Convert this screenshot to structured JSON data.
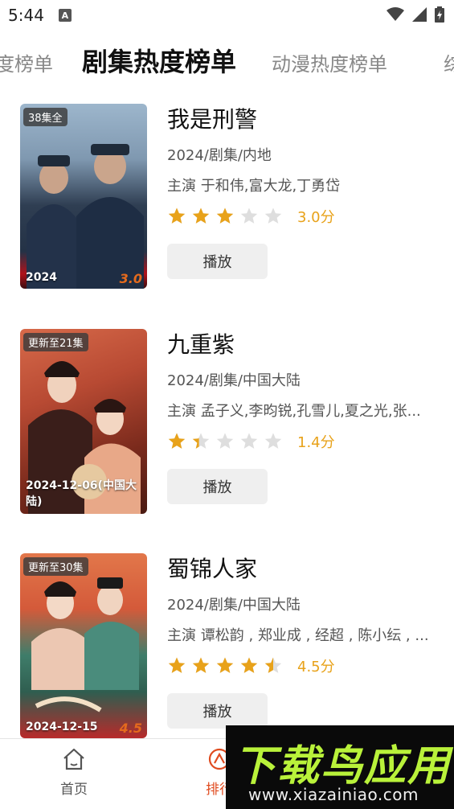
{
  "status": {
    "time": "5:44",
    "notif_icon": "A"
  },
  "tabs": [
    {
      "label": "度榜单",
      "active": false
    },
    {
      "label": "剧集热度榜单",
      "active": true
    },
    {
      "label": "动漫热度榜单",
      "active": false
    },
    {
      "label": "综",
      "active": false
    }
  ],
  "items": [
    {
      "title": "我是刑警",
      "badge": "38集全",
      "date": "2024",
      "poster_score": "3.0",
      "meta": "2024/剧集/内地",
      "cast": "主演 于和伟,富大龙,丁勇岱",
      "rating": 3.0,
      "rating_text": "3.0分",
      "play_label": "播放",
      "poster_colors": [
        "#8aa5bf",
        "#2d3b4e",
        "#b0121a"
      ]
    },
    {
      "title": "九重紫",
      "badge": "更新至21集",
      "date": "2024-12-06(中国大陆)",
      "poster_score": "",
      "meta": "2024/剧集/中国大陆",
      "cast": "主演 孟子义,李昀锐,孔雪儿,夏之光,张...",
      "rating": 1.4,
      "rating_text": "1.4分",
      "play_label": "播放",
      "poster_colors": [
        "#c9513a",
        "#6e2418",
        "#e7a07a"
      ]
    },
    {
      "title": "蜀锦人家",
      "badge": "更新至30集",
      "date": "2024-12-15",
      "poster_score": "4.5",
      "meta": "2024/剧集/中国大陆",
      "cast": "主演 谭松韵 , 郑业成 , 经超 , 陈小纭 , ...",
      "rating": 4.5,
      "rating_text": "4.5分",
      "play_label": "播放",
      "poster_colors": [
        "#d9643c",
        "#3a7a68",
        "#b82a2a"
      ]
    }
  ],
  "bottom_nav": [
    {
      "label": "首页",
      "icon": "home-icon",
      "active": false
    },
    {
      "label": "排行",
      "icon": "ranking-icon",
      "active": true
    }
  ],
  "watermark": {
    "title": "下载鸟应用",
    "url": "www.xiazainiao.com"
  },
  "colors": {
    "star_on": "#e8a21a",
    "star_off": "#dedede",
    "accent": "#e04b1f"
  }
}
